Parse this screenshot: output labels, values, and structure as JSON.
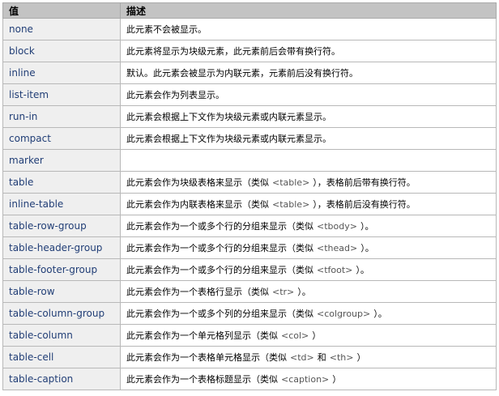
{
  "header": {
    "col_value": "值",
    "col_desc": "描述"
  },
  "rows": [
    {
      "value": "none",
      "desc": "此元素不会被显示。"
    },
    {
      "value": "block",
      "desc": "此元素将显示为块级元素，此元素前后会带有换行符。"
    },
    {
      "value": "inline",
      "desc": "默认。此元素会被显示为内联元素，元素前后没有换行符。"
    },
    {
      "value": "list-item",
      "desc": "此元素会作为列表显示。"
    },
    {
      "value": "run-in",
      "desc": "此元素会根据上下文作为块级元素或内联元素显示。"
    },
    {
      "value": "compact",
      "desc": "此元素会根据上下文作为块级元素或内联元素显示。"
    },
    {
      "value": "marker",
      "desc": ""
    },
    {
      "value": "table",
      "desc_pre": "此元素会作为块级表格来显示（类似",
      "code": "<table>",
      "desc_post": "），表格前后带有换行符。"
    },
    {
      "value": "inline-table",
      "desc_pre": "此元素会作为内联表格来显示（类似",
      "code": "<table>",
      "desc_post": "），表格前后没有换行符。"
    },
    {
      "value": "table-row-group",
      "desc_pre": "此元素会作为一个或多个行的分组来显示（类似",
      "code": "<tbody>",
      "desc_post": "）。"
    },
    {
      "value": "table-header-group",
      "desc_pre": "此元素会作为一个或多个行的分组来显示（类似",
      "code": "<thead>",
      "desc_post": "）。"
    },
    {
      "value": "table-footer-group",
      "desc_pre": "此元素会作为一个或多个行的分组来显示（类似",
      "code": "<tfoot>",
      "desc_post": "）。"
    },
    {
      "value": "table-row",
      "desc_pre": "此元素会作为一个表格行显示（类似",
      "code": "<tr>",
      "desc_post": "）。"
    },
    {
      "value": "table-column-group",
      "desc_pre": "此元素会作为一个或多个列的分组来显示（类似",
      "code": "<colgroup>",
      "desc_post": "）。"
    },
    {
      "value": "table-column",
      "desc_pre": "此元素会作为一个单元格列显示（类似",
      "code": "<col>",
      "desc_post": "）"
    },
    {
      "value": "table-cell",
      "desc_pre": "此元素会作为一个表格单元格显示（类似",
      "code": "<td>",
      "desc_mid": "和",
      "code2": "<th>",
      "desc_post": "）"
    },
    {
      "value": "table-caption",
      "desc_pre": "此元素会作为一个表格标题显示（类似",
      "code": "<caption>",
      "desc_post": "）"
    }
  ]
}
